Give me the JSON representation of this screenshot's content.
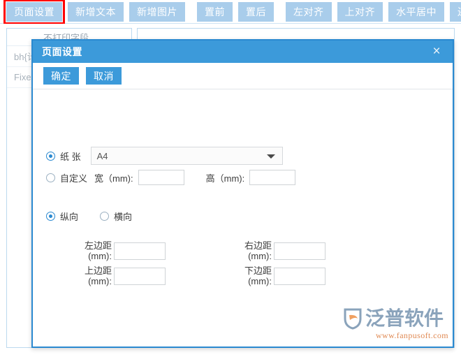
{
  "toolbar": {
    "buttons": [
      {
        "label": "页面设置",
        "selected": true
      },
      {
        "label": "新增文本",
        "selected": false
      },
      {
        "label": "新增图片",
        "selected": false
      },
      {
        "label": "置前",
        "selected": false
      },
      {
        "label": "置后",
        "selected": false
      },
      {
        "label": "左对齐",
        "selected": false
      },
      {
        "label": "上对齐",
        "selected": false
      },
      {
        "label": "水平居中",
        "selected": false
      },
      {
        "label": "还原",
        "selected": false
      }
    ]
  },
  "background": {
    "left_panel_header": "不打印字段",
    "rows": [
      "bh{计划",
      "FixedR"
    ]
  },
  "dialog": {
    "title": "页面设置",
    "close_icon": "×",
    "ok_label": "确定",
    "cancel_label": "取消",
    "paper": {
      "radio_label": "纸 张",
      "selected": "A4",
      "checked": true
    },
    "custom": {
      "radio_label": "自定义",
      "checked": false,
      "width_label": "宽（mm):",
      "width_value": "",
      "height_label": "高（mm):",
      "height_value": ""
    },
    "orientation": {
      "portrait_label": "纵向",
      "landscape_label": "横向",
      "selected": "纵向"
    },
    "margins": {
      "left_label": "左边距\n(mm):",
      "left_value": "",
      "right_label": "右边距\n(mm):",
      "right_value": "",
      "top_label": "上边距\n(mm):",
      "top_value": "",
      "bottom_label": "下边距\n(mm):",
      "bottom_value": ""
    }
  },
  "watermark": {
    "brand": "泛普软件",
    "url": "www.fanpusoft.com",
    "brand_color": "#8aa3bb",
    "url_color": "#e08a54"
  },
  "colors": {
    "toolbar_button": "#a9cdeb",
    "dialog_accent": "#3c9ada",
    "dialog_border": "#2a89d0",
    "selection_outline": "#ff0000"
  }
}
